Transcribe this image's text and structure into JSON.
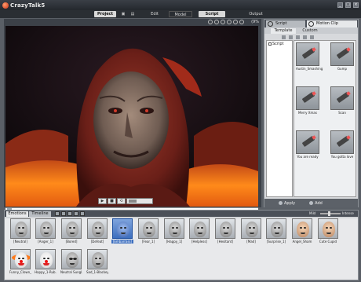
{
  "app": {
    "title": "CrazyTalk5"
  },
  "window_controls": {
    "minimize": "_",
    "maximize": "□",
    "close": "×"
  },
  "nav": {
    "project": "Project",
    "edit": "Edit",
    "model": "Model",
    "script": "Script",
    "output": "Output"
  },
  "viewport": {
    "zoom": "(9%"
  },
  "right_panel": {
    "tabs": {
      "script": "Script",
      "motion_clip": "Motion Clip"
    },
    "subtabs": {
      "template": "Template",
      "custom": "Custom"
    },
    "tree_items": [
      "Script"
    ],
    "clips": [
      {
        "label": "Austin_Smashing"
      },
      {
        "label": "Gump"
      },
      {
        "label": "Merry Xmas"
      },
      {
        "label": "Scan"
      },
      {
        "label": "You are ready"
      },
      {
        "label": "You gotta love"
      }
    ],
    "bottom": {
      "apply": "Apply",
      "add": "Add"
    }
  },
  "emotion_panel": {
    "tabs": {
      "emotions": "Emotions",
      "timeline": "Timeline"
    },
    "strength": {
      "low": "Mild",
      "high": "Intense"
    },
    "emotions": [
      {
        "label": "[Neutral]"
      },
      {
        "label": "[Anger_1]"
      },
      {
        "label": "[Bored]"
      },
      {
        "label": "[Defeat]"
      },
      {
        "label": "[Embarrass]"
      },
      {
        "label": "[Fear_1]"
      },
      {
        "label": "[Happy_1]"
      },
      {
        "label": "[Helpless]"
      },
      {
        "label": "[Hesitant]"
      },
      {
        "label": "[Mad]"
      },
      {
        "label": "[Surprise_1]"
      },
      {
        "label": "Angel_Sham"
      },
      {
        "label": "Cute Cupid"
      },
      {
        "label": "Funny_Clown_..."
      },
      {
        "label": "Happy_1-Rub..."
      },
      {
        "label": "Neutral Sungl..."
      },
      {
        "label": "Sad_1-Blackeye"
      }
    ]
  }
}
